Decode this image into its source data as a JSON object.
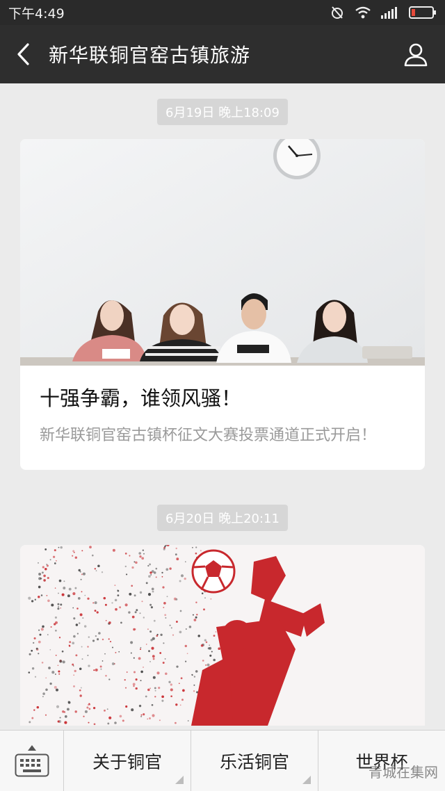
{
  "status_bar": {
    "time": "下午4:49"
  },
  "nav": {
    "title": "新华联铜官窑古镇旅游"
  },
  "messages": [
    {
      "timestamp": "6月19日 晚上18:09",
      "title": "十强争霸，谁领风骚！",
      "description": "新华联铜官窑古镇杯征文大赛投票通道正式开启！"
    },
    {
      "timestamp": "6月20日 晚上20:11"
    }
  ],
  "bottom_menu": {
    "items": [
      "关于铜官",
      "乐活铜官",
      "世界杯"
    ]
  },
  "watermark": "青城在集网",
  "colors": {
    "status_bg": "#2a2a2a",
    "nav_bg": "#2e2e2e",
    "page_bg": "#ebebeb",
    "chip_bg": "#d6d6d6",
    "accent_red": "#c8282d"
  }
}
